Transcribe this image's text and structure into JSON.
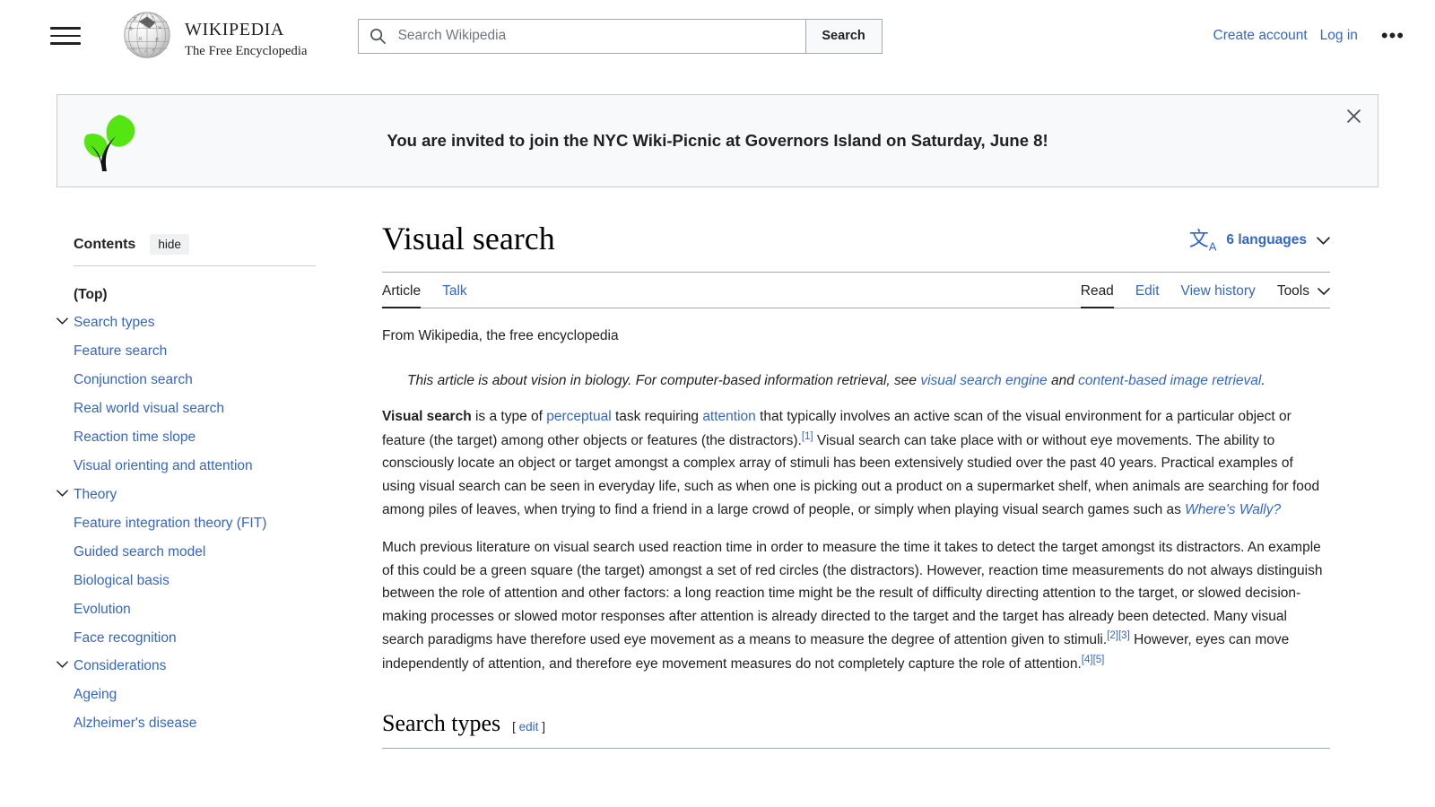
{
  "header": {
    "menu_icon": "hamburger-icon",
    "logo_alt": "wikipedia-globe-icon",
    "wordmark": "WIKIPEDIA",
    "tagline": "The Free Encyclopedia",
    "search": {
      "placeholder": "Search Wikipedia",
      "value": "",
      "icon": "search-icon",
      "button_label": "Search"
    },
    "create_account": "Create account",
    "log_in": "Log in",
    "more_icon": "ellipsis-icon"
  },
  "banner": {
    "icon": "leaf-sprout-icon",
    "message": "You are invited to join the NYC Wiki-Picnic at Governors Island on Saturday, June 8!",
    "close_icon": "close-icon"
  },
  "sidebar": {
    "title": "Contents",
    "hide_label": "hide",
    "items": [
      {
        "label": "(Top)",
        "level": 1,
        "chevron": false,
        "current": true
      },
      {
        "label": "Search types",
        "level": 1,
        "chevron": true
      },
      {
        "label": "Feature search",
        "level": 2,
        "chevron": false
      },
      {
        "label": "Conjunction search",
        "level": 2,
        "chevron": false
      },
      {
        "label": "Real world visual search",
        "level": 2,
        "chevron": false
      },
      {
        "label": "Reaction time slope",
        "level": 1,
        "chevron": false
      },
      {
        "label": "Visual orienting and attention",
        "level": 1,
        "chevron": false
      },
      {
        "label": "Theory",
        "level": 1,
        "chevron": true
      },
      {
        "label": "Feature integration theory (FIT)",
        "level": 2,
        "chevron": false
      },
      {
        "label": "Guided search model",
        "level": 2,
        "chevron": false
      },
      {
        "label": "Biological basis",
        "level": 1,
        "chevron": false
      },
      {
        "label": "Evolution",
        "level": 1,
        "chevron": false
      },
      {
        "label": "Face recognition",
        "level": 1,
        "chevron": false
      },
      {
        "label": "Considerations",
        "level": 1,
        "chevron": true
      },
      {
        "label": "Ageing",
        "level": 2,
        "chevron": false
      },
      {
        "label": "Alzheimer's disease",
        "level": 2,
        "chevron": false
      }
    ]
  },
  "article": {
    "title": "Visual search",
    "languages": {
      "icon": "translate-icon",
      "label": "6 languages",
      "chevron": "chevron-down-icon"
    },
    "tabs_left": [
      {
        "label": "Article",
        "active": true
      },
      {
        "label": "Talk",
        "active": false
      }
    ],
    "tabs_right": [
      {
        "label": "Read",
        "active": true
      },
      {
        "label": "Edit",
        "active": false
      },
      {
        "label": "View history",
        "active": false
      }
    ],
    "tools_label": "Tools",
    "from_line": "From Wikipedia, the free encyclopedia",
    "hatnote": {
      "text_1": "This article is about vision in biology. For computer-based information retrieval, see ",
      "link_1": "visual search engine",
      "text_2": " and ",
      "link_2": "content-based image retrieval",
      "text_3": "."
    },
    "paragraph_1": {
      "bold_lead": "Visual search",
      "t1": " is a type of ",
      "l1": "perceptual",
      "t2": " task requiring ",
      "l2": "attention",
      "t3": " that typically involves an active scan of the visual environment for a particular object or feature (the target) among other objects or features (the distractors).",
      "ref1": "[1]",
      "t4": " Visual search can take place with or without eye movements. The ability to consciously locate an object or target amongst a complex array of stimuli has been extensively studied over the past 40 years. Practical examples of using visual search can be seen in everyday life, such as when one is picking out a product on a supermarket shelf, when animals are searching for food among piles of leaves, when trying to find a friend in a large crowd of people, or simply when playing visual search games such as ",
      "l3": "Where's Wally?"
    },
    "paragraph_2": {
      "t1": "Much previous literature on visual search used reaction time in order to measure the time it takes to detect the target amongst its distractors. An example of this could be a green square (the target) amongst a set of red circles (the distractors). However, reaction time measurements do not always distinguish between the role of attention and other factors: a long reaction time might be the result of difficulty directing attention to the target, or slowed decision-making processes or slowed motor responses after attention is already directed to the target and the target has already been detected. Many visual search paradigms have therefore used eye movement as a means to measure the degree of attention given to stimuli.",
      "ref2": "[2]",
      "ref3": "[3]",
      "t2": " However, eyes can move independently of attention, and therefore eye movement measures do not completely capture the role of attention.",
      "ref4": "[4]",
      "ref5": "[5]"
    },
    "section_heading": {
      "label": "Search types",
      "edit_open": "[",
      "edit_label": "edit",
      "edit_close": "]"
    }
  },
  "colors": {
    "link": "#3366cc",
    "text": "#202122",
    "banner_bg": "#f8f9fa",
    "border": "#a2a9b1",
    "leaf_green": "#55e512"
  }
}
